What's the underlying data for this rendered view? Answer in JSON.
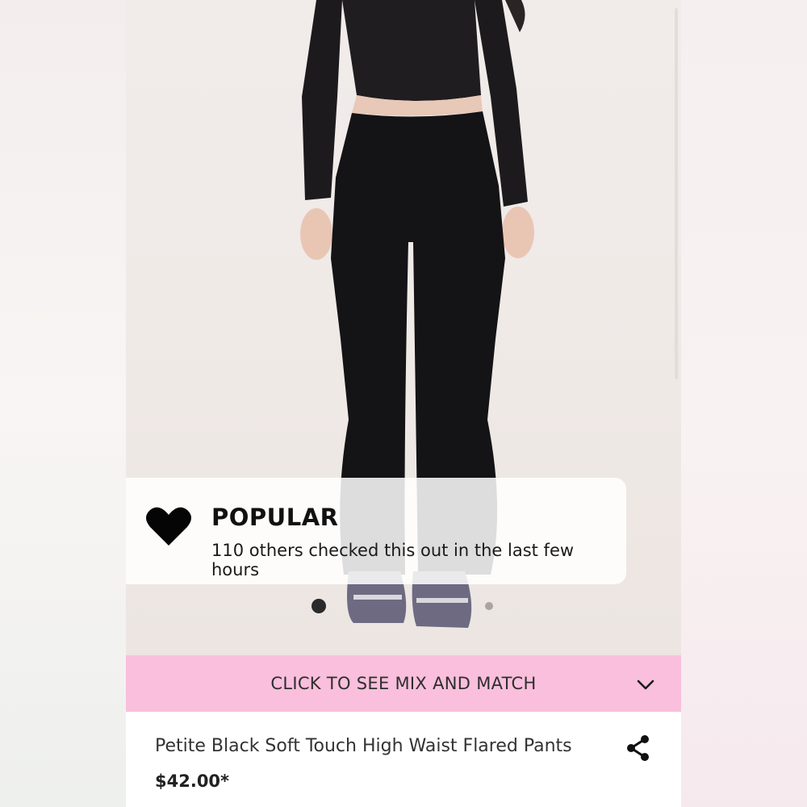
{
  "popular": {
    "title": "POPULAR",
    "subtitle": "110 others checked this out in the last few hours",
    "icon": "heart-icon"
  },
  "carousel": {
    "current": 1,
    "total": 2
  },
  "mix_match": {
    "label": "CLICK TO SEE MIX AND MATCH",
    "icon": "chevron-down-icon"
  },
  "product": {
    "name": "Petite Black Soft Touch High Waist Flared Pants",
    "price": "$42.00*",
    "share_icon": "share-icon"
  },
  "colors": {
    "accent_pink": "#f9bfdc",
    "text_dark": "#111111"
  }
}
